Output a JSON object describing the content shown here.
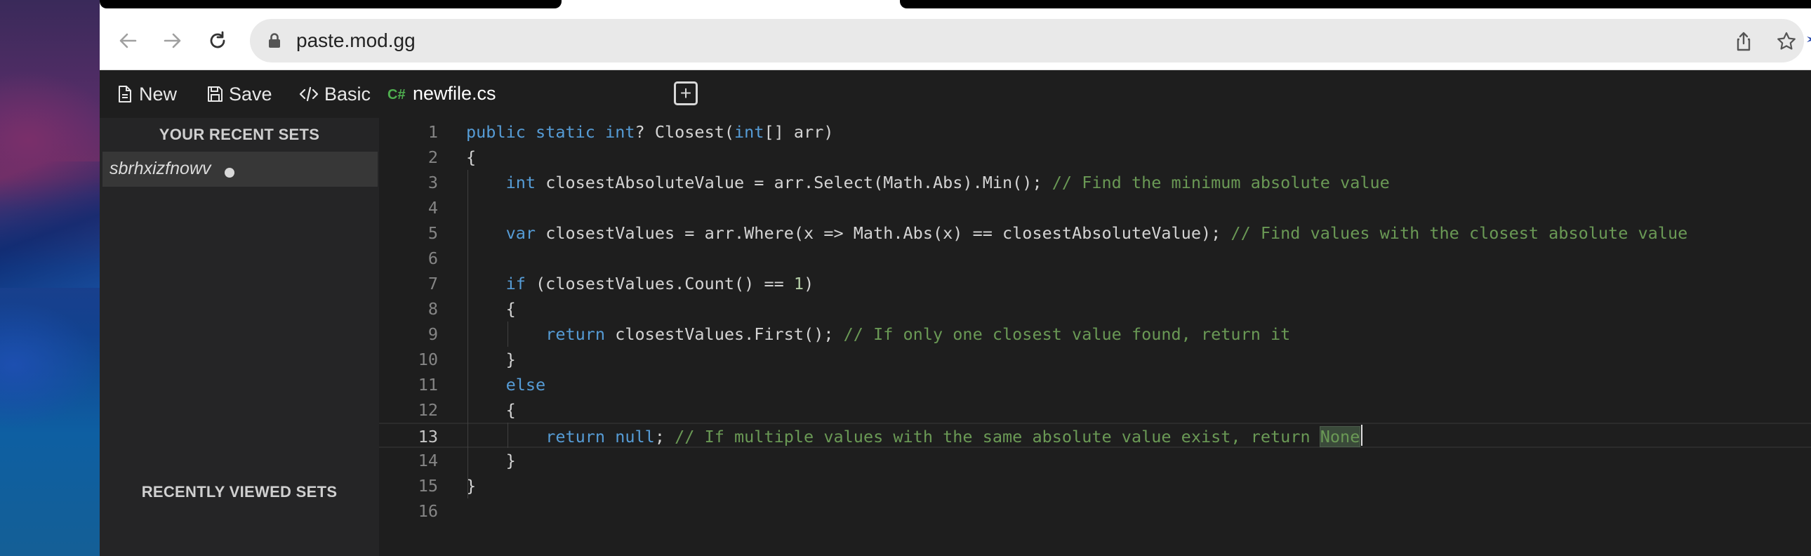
{
  "browser": {
    "url": "paste.mod.gg",
    "icons": [
      "back-arrow-icon",
      "forward-arrow-icon",
      "reload-icon",
      "lock-icon",
      "share-icon",
      "bookmark-star-icon"
    ]
  },
  "header": {
    "new_label": "New",
    "save_label": "Save",
    "basic_label": "Basic",
    "file_tab": {
      "lang_badge": "C#",
      "filename": "newfile.cs"
    }
  },
  "sidebar": {
    "recent_heading": "YOUR RECENT SETS",
    "recent_items": [
      {
        "name": "sbrhxizfnowv"
      }
    ],
    "viewed_heading": "RECENTLY VIEWED SETS"
  },
  "editor": {
    "current_line": 13,
    "colors": {
      "keyword": "#569cd6",
      "comment": "#6a9955",
      "number": "#b5cea8",
      "text": "#d4d4d4"
    },
    "lines": [
      "public static int? Closest(int[] arr)",
      "{",
      "    int closestAbsoluteValue = arr.Select(Math.Abs).Min(); // Find the minimum absolute value",
      "",
      "    var closestValues = arr.Where(x => Math.Abs(x) == closestAbsoluteValue); // Find values with the closest absolute value",
      "",
      "    if (closestValues.Count() == 1)",
      "    {",
      "        return closestValues.First(); // If only one closest value found, return it",
      "    }",
      "    else",
      "    {",
      "        return null; // If multiple values with the same absolute value exist, return None",
      "    }",
      "}",
      ""
    ]
  }
}
